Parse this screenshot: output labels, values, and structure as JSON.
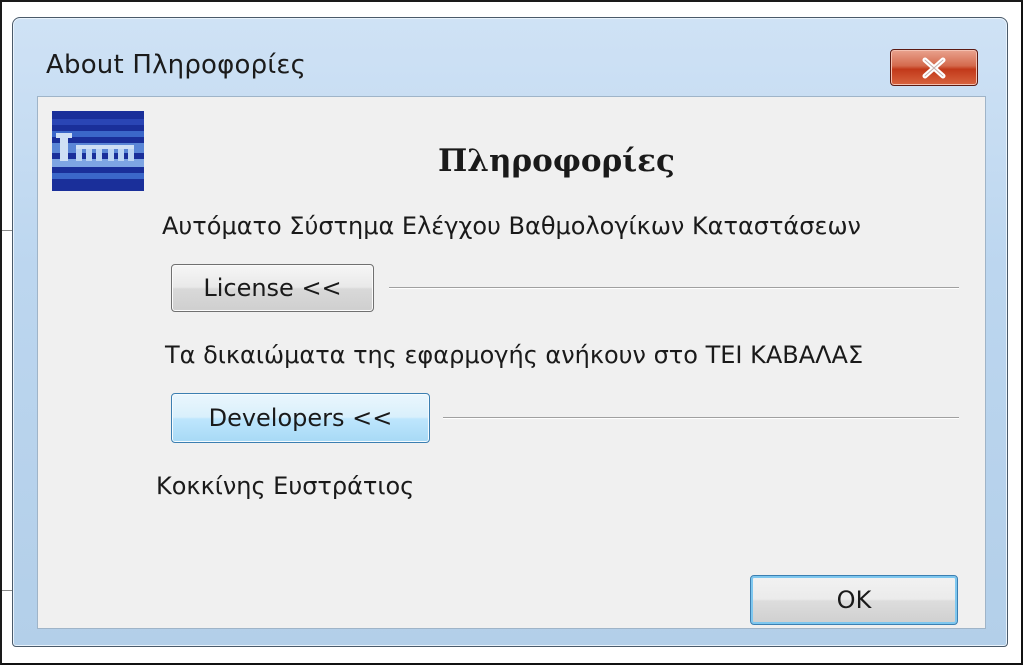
{
  "window": {
    "title": "About Πληροφορίες",
    "close_icon": "close-x-icon"
  },
  "logo": {
    "icon": "app-logo-icon",
    "colors": {
      "dark_blue": "#1a2f9a",
      "mid_blue": "#3b67c9",
      "light": "#cfe0f5"
    }
  },
  "content": {
    "heading": "Πληροφορίες",
    "product_name": "Αυτόματο Σύστημα Ελέγχου Βαθμολογίκων Καταστάσεων",
    "license_button": "License <<",
    "rights_text": "Τα δικαιώματα της εφαρμογής ανήκουν στο ΤΕΙ ΚΑΒΑΛΑΣ",
    "developers_button": "Developers <<",
    "developer_name": "Κοκκίνης Ευστράτιος",
    "ok_button": "OK"
  },
  "colors": {
    "title_bar": "#bcd6ef",
    "close_button": "#c2391a",
    "client_bg": "#f0f0f0",
    "focus_border": "#3c7fb1"
  }
}
